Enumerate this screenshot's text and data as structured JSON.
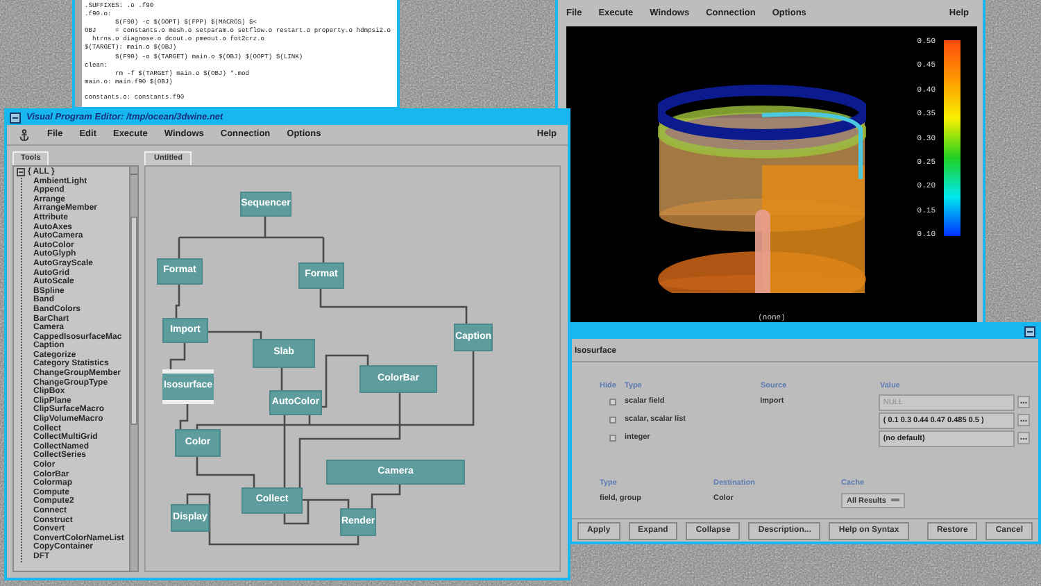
{
  "editor": {
    "blocks": [
      {
        "lines": [
          ".SUFFIXES: .o .f90",
          ".f90.o:",
          "        $(F90) -c $(OOPT) $(FPP) $(MACROS) $<",
          "OBJ     = constants.o mesh.o setparam.o setflow.o restart.o property.o hdmpsi2.o",
          "  htrns.o diagnose.o dcout.o pmeout.o fot2crz.o",
          "$(TARGET): main.o $(OBJ)",
          "        $(F90) -o $(TARGET) main.o $(OBJ) $(OOPT) $(LINK)",
          "clean:",
          "        rm -f $(TARGET) main.o $(OBJ) *.mod",
          "main.o: main.f90 $(OBJ)"
        ]
      },
      {
        "lines": [
          "constants.o: constants.f90"
        ]
      }
    ]
  },
  "program_editor": {
    "title": "Visual Program Editor: /tmp/ocean/3dwine.net",
    "menu": [
      "File",
      "Edit",
      "Execute",
      "Windows",
      "Connection",
      "Options"
    ],
    "help": "Help",
    "tools_tab": "Tools",
    "tools": [
      {
        "label": "{ ALL }",
        "expanded": true,
        "children": [
          {
            "label": "AmbientLight"
          },
          {
            "label": "Append"
          },
          {
            "label": "Arrange"
          },
          {
            "label": "ArrangeMember"
          },
          {
            "label": "Attribute"
          },
          {
            "label": "AutoAxes"
          },
          {
            "label": "AutoCamera"
          },
          {
            "label": "AutoColor"
          },
          {
            "label": "AutoGlyph"
          },
          {
            "label": "AutoGrayScale"
          },
          {
            "label": "AutoGrid"
          },
          {
            "label": "AutoScale"
          },
          {
            "label": "BSpline"
          },
          {
            "label": "Band"
          },
          {
            "label": "BandColors"
          },
          {
            "label": "BarChart"
          },
          {
            "label": "Camera"
          },
          {
            "label": "CappedIsosurfaceMac"
          },
          {
            "label": "Caption"
          },
          {
            "label": "Categorize"
          },
          {
            "label": "Category Statistics"
          },
          {
            "label": "ChangeGroupMember"
          },
          {
            "label": "ChangeGroupType"
          },
          {
            "label": "ClipBox"
          },
          {
            "label": "ClipPlane"
          },
          {
            "label": "ClipSurfaceMacro"
          },
          {
            "label": "ClipVolumeMacro"
          },
          {
            "label": "Collect"
          },
          {
            "label": "CollectMultiGrid"
          },
          {
            "label": "CollectNamed"
          },
          {
            "label": "CollectSeries"
          },
          {
            "label": "Color"
          },
          {
            "label": "ColorBar"
          },
          {
            "label": "Colormap"
          },
          {
            "label": "Compute"
          },
          {
            "label": "Compute2"
          },
          {
            "label": "Connect"
          },
          {
            "label": "Construct"
          },
          {
            "label": "Convert"
          },
          {
            "label": "ConvertColorNameList"
          },
          {
            "label": "CopyContainer"
          },
          {
            "label": "DFT"
          }
        ]
      }
    ],
    "canvas_tab": "Untitled",
    "nodes": [
      {
        "label": "Sequencer",
        "selected": false
      },
      {
        "label": "Format",
        "selected": false
      },
      {
        "label": "Format",
        "selected": false
      },
      {
        "label": "Import",
        "selected": false
      },
      {
        "label": "Slab",
        "selected": false
      },
      {
        "label": "Caption",
        "selected": false
      },
      {
        "label": "Isosurface",
        "selected": true
      },
      {
        "label": "AutoColor",
        "selected": false
      },
      {
        "label": "ColorBar",
        "selected": false
      },
      {
        "label": "Color",
        "selected": false
      },
      {
        "label": "Camera",
        "selected": false
      },
      {
        "label": "Collect",
        "selected": false
      },
      {
        "label": "Display",
        "selected": false
      },
      {
        "label": "Render",
        "selected": false
      }
    ]
  },
  "image_window": {
    "menu": [
      "File",
      "Execute",
      "Windows",
      "Connection",
      "Options"
    ],
    "help": "Help",
    "colorbar_labels": [
      "0.50",
      "0.45",
      "0.40",
      "0.35",
      "0.30",
      "0.25",
      "0.20",
      "0.15",
      "0.10"
    ],
    "caption": "(none)"
  },
  "dialog": {
    "module": "Isosurface",
    "headers": {
      "hide": "Hide",
      "type": "Type",
      "source": "Source",
      "value": "Value"
    },
    "inputs": [
      {
        "type": "scalar field",
        "source": "Import",
        "hidden": false,
        "placeholder": "NULL"
      },
      {
        "type": "scalar, scalar list",
        "hidden": false,
        "value": "( 0.1 0.3 0.44 0.47 0.485 0.5 )"
      },
      {
        "type": "integer",
        "hidden": false,
        "value": "(no default)"
      }
    ],
    "output": {
      "type_label": "Type",
      "type": "field, group",
      "destination_label": "Destination",
      "destination": "Color",
      "cache_label": "Cache",
      "cache": "All Results"
    },
    "buttons_left": [
      "Apply",
      "Expand",
      "Collapse",
      "Description...",
      "Help on Syntax"
    ],
    "buttons_right": [
      "Restore",
      "Cancel"
    ]
  }
}
